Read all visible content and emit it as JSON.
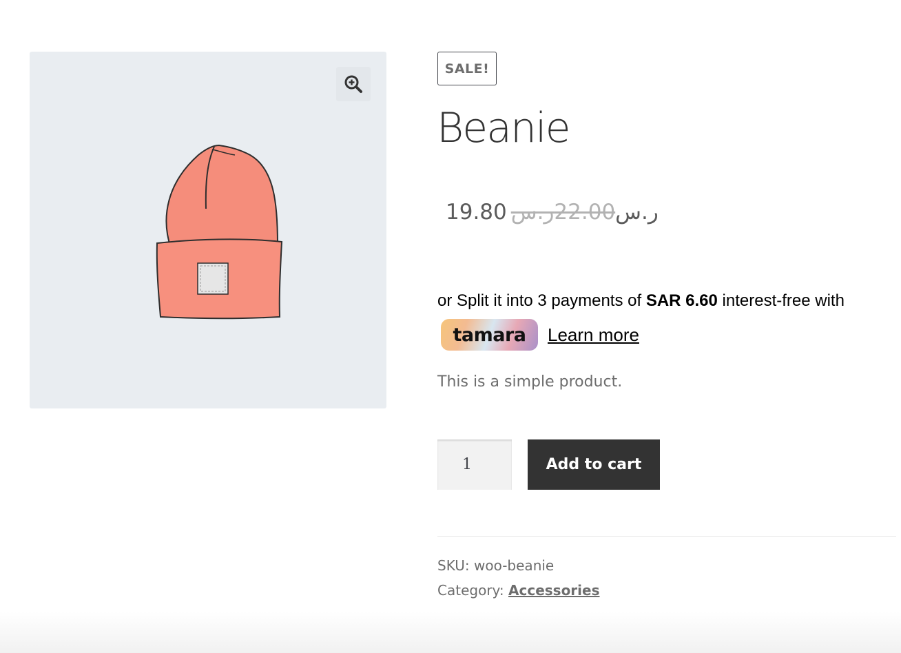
{
  "gallery": {
    "zoom_icon": "zoom-in-icon",
    "image_subject": "beanie"
  },
  "product": {
    "sale_badge": "SALE!",
    "title": "Beanie",
    "sale_price": "19.80ر.س",
    "regular_price": "22.00ر.س",
    "short_description": "This is a simple product."
  },
  "tamara": {
    "prefix": "or Split it into 3 payments of ",
    "amount": "SAR 6.60",
    "suffix": " interest-free with",
    "logo_text": "tamara",
    "learn_more": "Learn more"
  },
  "cart": {
    "quantity": "1",
    "add_to_cart_label": "Add to cart"
  },
  "meta": {
    "sku_label": "SKU:",
    "sku_value": "woo-beanie",
    "category_label": "Category:",
    "category_value": "Accessories"
  },
  "colors": {
    "button_bg": "#333333",
    "gallery_bg": "#e9edf1",
    "beanie": "#f48a78"
  }
}
